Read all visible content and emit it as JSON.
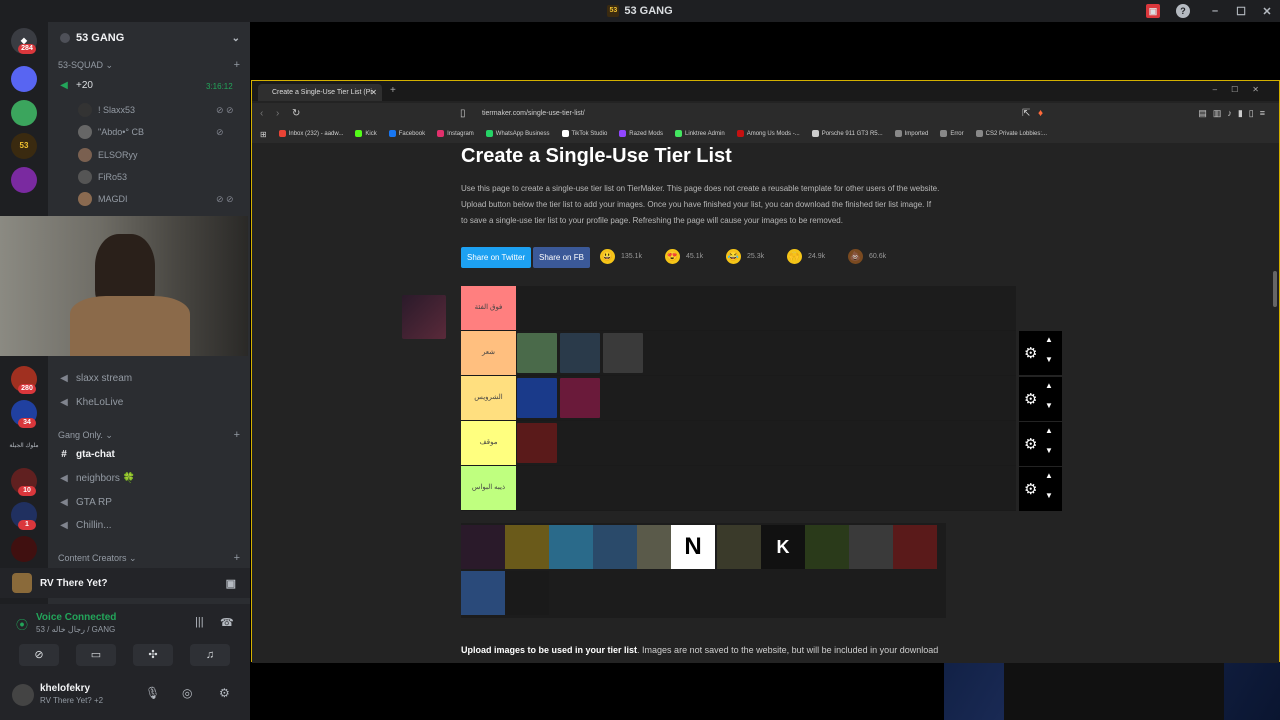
{
  "app": {
    "title": "53 GANG",
    "logo_text": "53"
  },
  "guilds": [
    {
      "name": "discord-home-icon",
      "badge": "284",
      "color": "#da373c"
    },
    {
      "name": "guild-1",
      "badge": "",
      "color": "#5865f2"
    },
    {
      "name": "guild-2",
      "badge": "",
      "color": "#3ba55d"
    },
    {
      "name": "guild-53",
      "badge": "",
      "color": "#3a2a10"
    },
    {
      "name": "guild-4",
      "badge": "",
      "color": "#7a2aa0"
    },
    {
      "name": "guild-5",
      "badge": "280",
      "color": "#a03020"
    },
    {
      "name": "guild-6",
      "badge": "34",
      "color": "#2040a0"
    },
    {
      "name": "guild-7",
      "badge": "10",
      "color": "#602020"
    },
    {
      "name": "guild-8",
      "badge": "1",
      "color": "#203060"
    },
    {
      "name": "guild-9",
      "badge": "",
      "color": "#401010"
    }
  ],
  "guild_label_text": "ملوك الجيلة",
  "server": {
    "name": "53 GANG",
    "voice_category": "53-SQUAD",
    "voice_channel": "+20",
    "voice_timer": "3:16:12",
    "voice_users": [
      "! Slaxx53",
      "\"Abdo•° CB",
      "ELSORyy",
      "FiRo53",
      "MAGDI"
    ],
    "channels": [
      {
        "label": "slaxx stream",
        "active": false
      },
      {
        "label": "KheLoLive",
        "active": false
      }
    ],
    "category_gang": "Gang Only.",
    "gang_channels": [
      {
        "label": "gta-chat",
        "icon": "#",
        "active": true
      },
      {
        "label": "neighbors 🍀",
        "icon": "◀",
        "active": false
      },
      {
        "label": "GTA RP",
        "icon": "◀",
        "active": false
      },
      {
        "label": "Chillin...",
        "icon": "◀",
        "active": false
      }
    ],
    "category_creators": "Content Creators"
  },
  "activity": {
    "title": "RV There Yet?"
  },
  "voice": {
    "status": "Voice Connected",
    "channel": "53 / رجال خاله / GANG"
  },
  "user": {
    "name": "khelofekry",
    "status": "RV There Yet? +2"
  },
  "browser": {
    "tab_title": "Create a Single-Use Tier List (Pi",
    "url": "tiermaker.com/single-use-tier-list/",
    "bookmarks": [
      {
        "label": "Inbox (232) - aadw...",
        "color": "#ea4335"
      },
      {
        "label": "Kick",
        "color": "#53fc18"
      },
      {
        "label": "Facebook",
        "color": "#1877f2"
      },
      {
        "label": "Instagram",
        "color": "#e1306c"
      },
      {
        "label": "WhatsApp Business",
        "color": "#25d366"
      },
      {
        "label": "TikTok Studio",
        "color": "#ffffff"
      },
      {
        "label": "Razed Mods",
        "color": "#9146ff"
      },
      {
        "label": "Linktree Admin",
        "color": "#43e660"
      },
      {
        "label": "Among Us Mods -...",
        "color": "#c51111"
      },
      {
        "label": "Porsche 911 GT3 R5...",
        "color": "#cccccc"
      },
      {
        "label": "Imported",
        "color": "#888888"
      },
      {
        "label": "Error",
        "color": "#888888"
      },
      {
        "label": "CS2 Private Lobbies:...",
        "color": "#888888"
      }
    ]
  },
  "page": {
    "title": "Create a Single-Use Tier List",
    "desc_line1": "Use this page to create a single-use tier list on TierMaker. This page does not create a reusable template for other users of the website.",
    "desc_line2": "Upload button below the tier list to add your images. Once you have finished your list, you can download the finished tier list image. If",
    "desc_line3": "to save a single-use tier list to your profile page. Refreshing the page will cause your images to be removed.",
    "share_twitter": "Share on Twitter",
    "share_fb": "Share on FB",
    "reactions": [
      {
        "emoji": "😃",
        "count": "135.1k"
      },
      {
        "emoji": "😍",
        "count": "45.1k"
      },
      {
        "emoji": "😂",
        "count": "25.3k"
      },
      {
        "emoji": "🙌",
        "count": "24.9k"
      },
      {
        "emoji": "💩",
        "count": "60.6k"
      }
    ],
    "tiers": [
      {
        "label": "فوق الفئة",
        "color": "#ff7f7f"
      },
      {
        "label": "شعر",
        "color": "#ffbf7f"
      },
      {
        "label": "الشرويس",
        "color": "#ffdf7f"
      },
      {
        "label": "موقف",
        "color": "#ffff7f"
      },
      {
        "label": "ذيبه البواس",
        "color": "#bfff7f"
      }
    ],
    "upload_bold": "Upload images to be used in your tier list",
    "upload_rest": ". Images are not saved to the website, but will be included in your download"
  }
}
